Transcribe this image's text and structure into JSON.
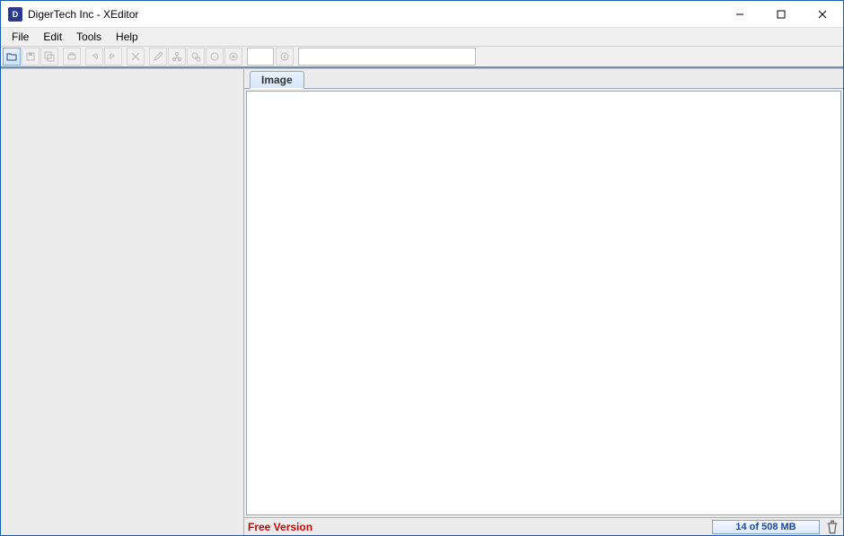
{
  "titlebar": {
    "app_icon_text": "D",
    "title": "DigerTech Inc - XEditor"
  },
  "menubar": {
    "items": [
      "File",
      "Edit",
      "Tools",
      "Help"
    ]
  },
  "toolbar": {
    "icons": [
      "open-icon",
      "save-icon",
      "saveall-icon",
      "print-icon",
      "undo-icon",
      "redo-icon",
      "cut-icon",
      "edit-icon",
      "tree-icon",
      "find-icon",
      "stop-icon",
      "settings-icon"
    ],
    "zoom_value": "",
    "back_icon": "back-icon",
    "search_value": ""
  },
  "tabs": {
    "items": [
      "Image"
    ]
  },
  "statusbar": {
    "version_label": "Free Version",
    "memory_label": "14 of 508 MB"
  }
}
